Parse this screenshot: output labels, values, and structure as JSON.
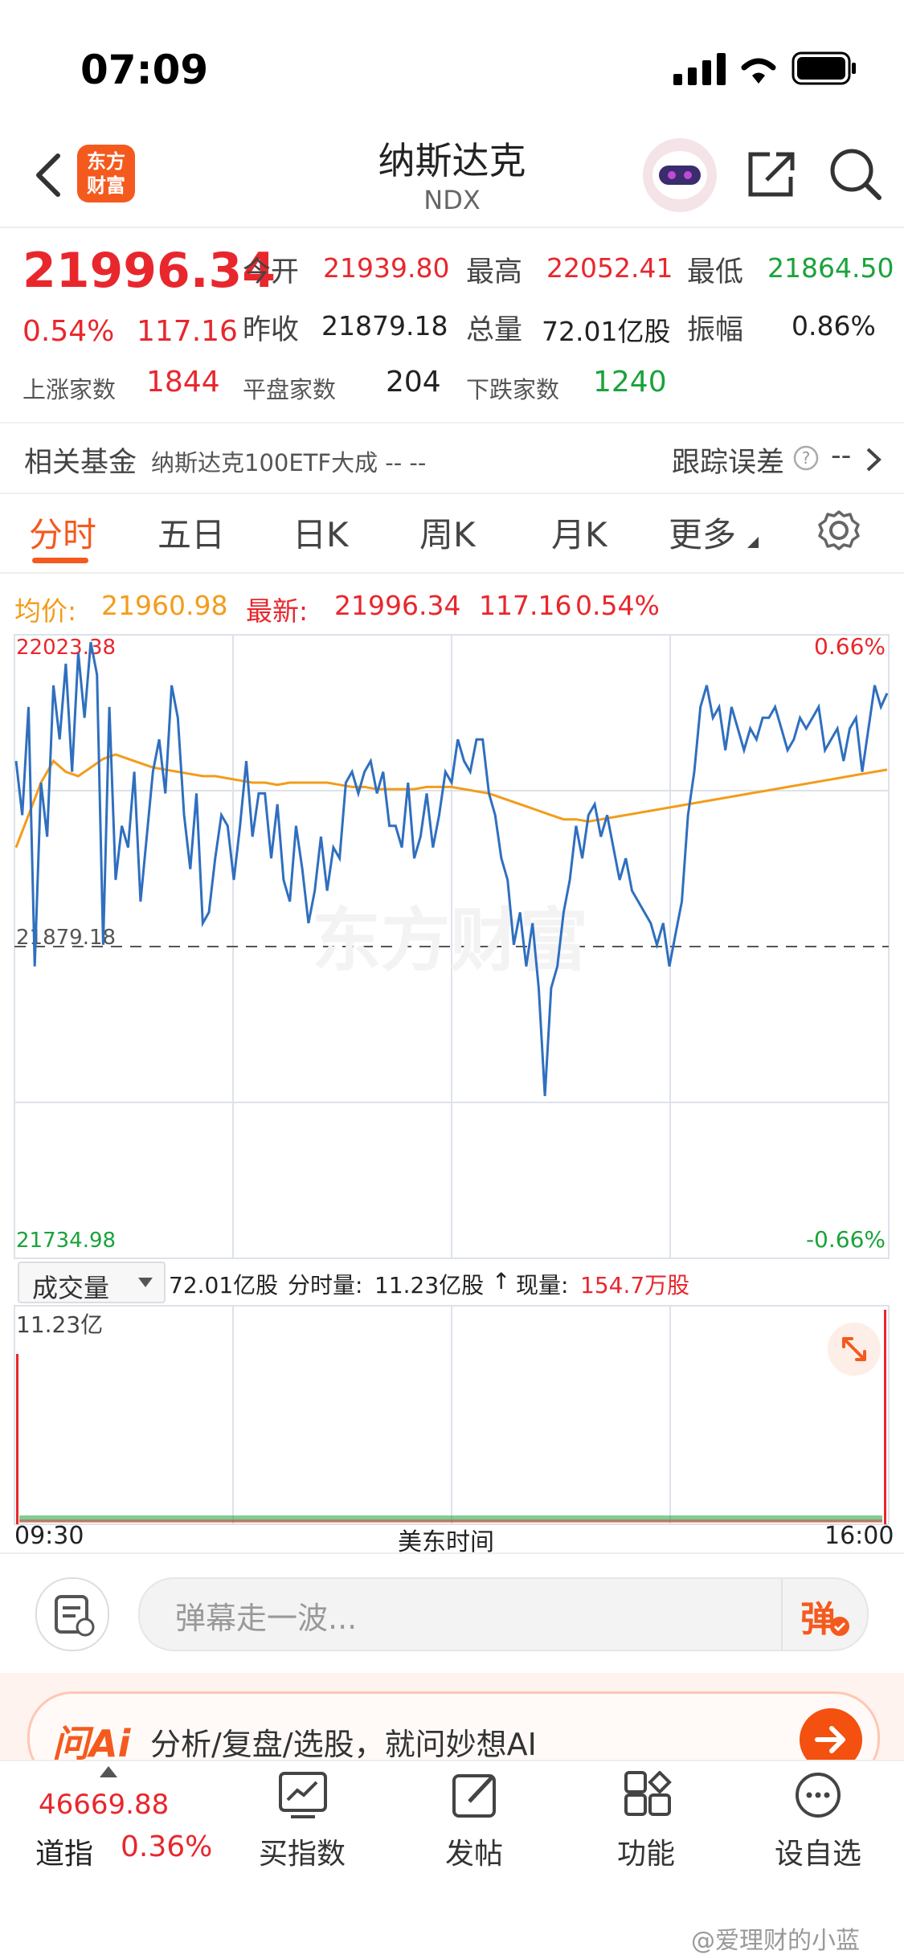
{
  "status": {
    "time": "07:09"
  },
  "header": {
    "title": "纳斯达克",
    "subtitle": "NDX",
    "logo_line1": "东方",
    "logo_line2": "财富"
  },
  "quote": {
    "price": "21996.34",
    "change_pct": "0.54%",
    "change": "117.16",
    "open_label": "今开",
    "open": "21939.80",
    "high_label": "最高",
    "high": "22052.41",
    "low_label": "最低",
    "low": "21864.50",
    "prev_label": "昨收",
    "prev": "21879.18",
    "volume_label": "总量",
    "volume": "72.01亿股",
    "amp_label": "振幅",
    "amplitude": "0.86%",
    "up_label": "上涨家数",
    "up": "1844",
    "flat_label": "平盘家数",
    "flat": "204",
    "down_label": "下跌家数",
    "down": "1240"
  },
  "fund": {
    "label": "相关基金",
    "name": "纳斯达克100ETF大成 -- --",
    "track_label": "跟踪误差",
    "track_value": "--"
  },
  "tabs": [
    "分时",
    "五日",
    "日K",
    "周K",
    "月K",
    "更多"
  ],
  "chart_header": {
    "avg_label": "均价:",
    "avg": "21960.98",
    "latest_label": "最新:",
    "latest": "21996.34",
    "latest_change": "117.16",
    "latest_pct": "0.54%"
  },
  "chart_data": {
    "type": "line",
    "y_top_label": "22023.38",
    "y_mid_label": "21879.18",
    "y_bottom_label": "21734.98",
    "pct_top_label": "0.66%",
    "pct_bottom_label": "-0.66%",
    "ylim": [
      21734.98,
      22023.38
    ],
    "reference": 21879.18,
    "x_start": "09:30",
    "x_end": "16:00",
    "x_label": "美东时间",
    "watermark": "东方财富",
    "colors": {
      "price": "#2f6fbf",
      "avg": "#f39c1b",
      "up": "#e8272d",
      "down": "#1aa33b"
    },
    "series": [
      {
        "values": [
          21965,
          21940,
          21990,
          21870,
          21955,
          21930,
          22000,
          21975,
          22010,
          21960,
          22015,
          21985,
          22020,
          22005,
          21880,
          21990,
          21910,
          21935,
          21925,
          21960,
          21900,
          21930,
          21960,
          21975,
          21950,
          22000,
          21985,
          21940,
          21915,
          21950,
          21890,
          21895,
          21920,
          21940,
          21935,
          21910,
          21935,
          21965,
          21930,
          21950,
          21950,
          21920,
          21945,
          21910,
          21900,
          21935,
          21915,
          21890,
          21905,
          21930,
          21905,
          21925,
          21920,
          21955,
          21960,
          21950,
          21960,
          21965,
          21950,
          21960,
          21935,
          21935,
          21925,
          21955,
          21920,
          21930,
          21950,
          21925,
          21940,
          21960,
          21955,
          21975,
          21965,
          21960,
          21975,
          21975,
          21950,
          21940,
          21920,
          21910,
          21880,
          21895,
          21870,
          21890,
          21860,
          21810,
          21860,
          21870,
          21895,
          21910,
          21935,
          21920,
          21940,
          21945,
          21930,
          21940,
          21925,
          21910,
          21920,
          21905,
          21900,
          21895,
          21890,
          21880,
          21890,
          21870,
          21885,
          21900,
          21940,
          21960,
          21990,
          22000,
          21985,
          21990,
          21970,
          21990,
          21980,
          21970,
          21980,
          21975,
          21985,
          21985,
          21990,
          21980,
          21970,
          21975,
          21985,
          21980,
          21985,
          21990,
          21970,
          21975,
          21980,
          21965,
          21980,
          21985,
          21960,
          21980,
          22000,
          21990,
          21996.34
        ]
      },
      {
        "values": [
          21925,
          21940,
          21955,
          21965,
          21960,
          21958,
          21962,
          21966,
          21968,
          21966,
          21964,
          21962,
          21961,
          21960,
          21959,
          21958,
          21958,
          21957,
          21956,
          21955,
          21955,
          21954,
          21955,
          21955,
          21955,
          21955,
          21954,
          21953,
          21953,
          21952,
          21952,
          21952,
          21952,
          21953,
          21953,
          21953,
          21952,
          21951,
          21950,
          21948,
          21946,
          21944,
          21942,
          21940,
          21938,
          21938,
          21937,
          21938,
          21939,
          21940,
          21941,
          21942,
          21943,
          21944,
          21945,
          21946,
          21947,
          21948,
          21949,
          21950,
          21951,
          21952,
          21953,
          21954,
          21955,
          21956,
          21957,
          21958,
          21959,
          21960,
          21960.98
        ]
      }
    ]
  },
  "volume": {
    "selector": "成交量",
    "total": "72.01亿股",
    "interval_label": "分时量:",
    "interval": "11.23亿股",
    "arrow": "↑",
    "current_label": "现量:",
    "current": "154.7万股",
    "max_label": "11.23亿"
  },
  "danmu": {
    "placeholder": "弹幕走一波...",
    "send": "弹"
  },
  "ai": {
    "logo": "问Ai",
    "text": "分析/复盘/选股，就问妙想AI"
  },
  "tabbar": {
    "index_value": "46669.88",
    "index_name": "道指",
    "index_pct": "0.36%",
    "items": [
      "买指数",
      "发帖",
      "功能",
      "设自选"
    ]
  },
  "watermark": "@爱理财的小蓝"
}
